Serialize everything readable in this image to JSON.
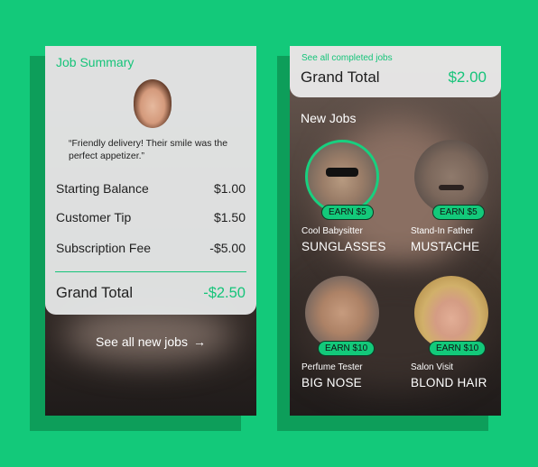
{
  "colors": {
    "background": "#13c97a",
    "accent": "#16c47a"
  },
  "summary": {
    "title": "Job Summary",
    "quote": "“Friendly delivery! Their smile was the perfect appetizer.”",
    "rows": [
      {
        "label": "Starting Balance",
        "value": "$1.00"
      },
      {
        "label": "Customer Tip",
        "value": "$1.50"
      },
      {
        "label": "Subscription Fee",
        "value": "-$5.00"
      }
    ],
    "grand_total_label": "Grand Total",
    "grand_total_value": "-$2.50",
    "see_new_label": "See all new jobs",
    "see_new_icon": "arrow-right-icon"
  },
  "jobs_screen": {
    "completed_link": "See all completed jobs",
    "grand_total_label": "Grand Total",
    "grand_total_value": "$2.00",
    "section_title": "New Jobs",
    "jobs": [
      {
        "earn": "EARN $5",
        "role": "Cool Babysitter",
        "trait": "SUNGLASSES"
      },
      {
        "earn": "EARN $5",
        "role": "Stand-In Father",
        "trait": "MUSTACHE"
      },
      {
        "earn": "EARN $10",
        "role": "Perfume Tester",
        "trait": "BIG NOSE"
      },
      {
        "earn": "EARN $10",
        "role": "Salon Visit",
        "trait": "BLOND HAIR"
      }
    ]
  }
}
